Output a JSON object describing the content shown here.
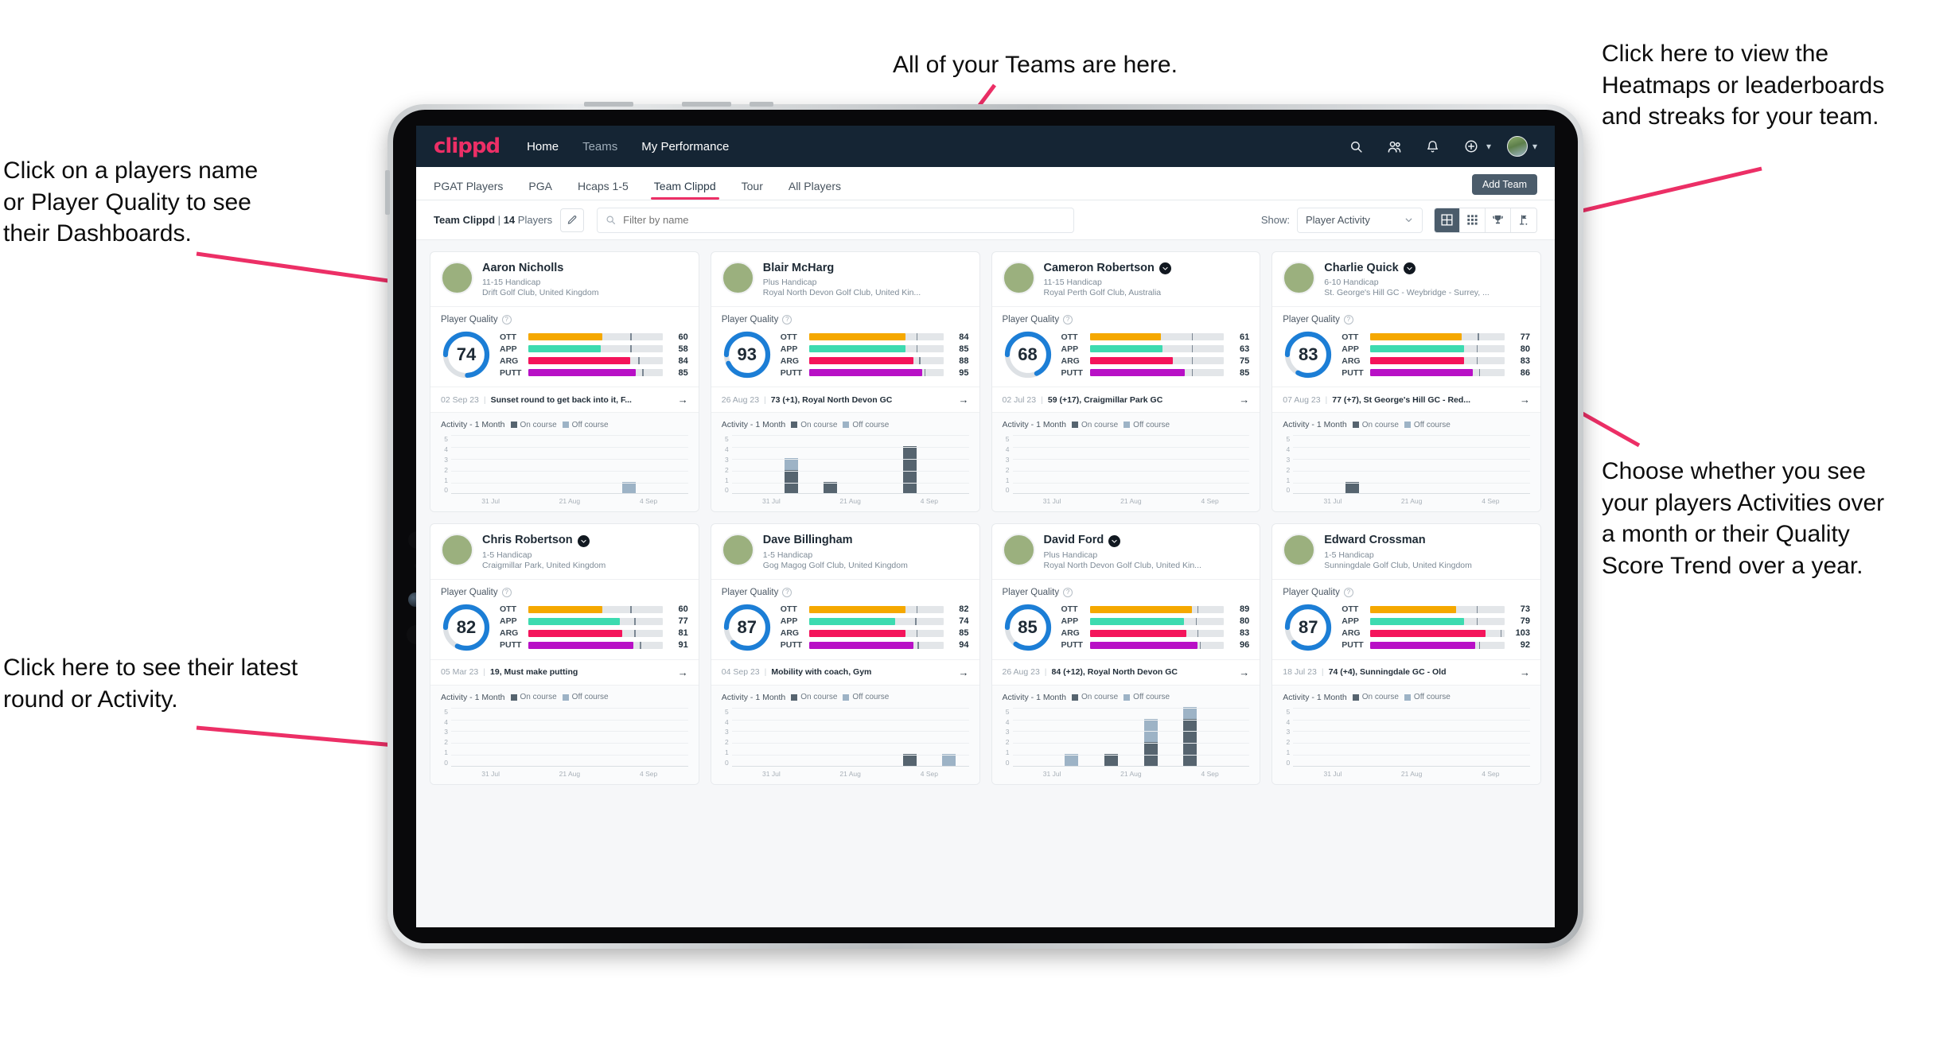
{
  "annotations": {
    "teams": "All of your Teams are here.",
    "heatmaps": "Click here to view the\nHeatmaps or leaderboards\nand streaks for your team.",
    "names": "Click on a players name\nor Player Quality to see\ntheir Dashboards.",
    "show": "Choose whether you see\nyour players Activities over\na month or their Quality\nScore Trend over a year.",
    "round": "Click here to see their latest\nround or Activity."
  },
  "colors": {
    "brand_pink": "#ec2f66",
    "topbar": "#152534",
    "ott": "#f5a800",
    "app": "#3ddbb0",
    "arg": "#f4145b",
    "putt": "#b810c6",
    "gauge": "#1c7ed6",
    "on_course": "#56646f",
    "off_course": "#9db3c6"
  },
  "topbar": {
    "logo": "clippd",
    "links": [
      {
        "label": "Home",
        "active": true
      },
      {
        "label": "Teams",
        "active": false
      },
      {
        "label": "My Performance",
        "active": true
      }
    ],
    "icons": [
      "search-icon",
      "people-icon",
      "bell-icon",
      "plus-circle-icon",
      "avatar"
    ]
  },
  "tabs": {
    "items": [
      {
        "label": "PGAT Players",
        "active": false
      },
      {
        "label": "PGA",
        "active": false
      },
      {
        "label": "Hcaps 1-5",
        "active": false
      },
      {
        "label": "Team Clippd",
        "active": true
      },
      {
        "label": "Tour",
        "active": false
      },
      {
        "label": "All Players",
        "active": false
      }
    ],
    "add_team": "Add Team"
  },
  "filterbar": {
    "team_name": "Team Clippd",
    "separator": "|",
    "player_count": "14",
    "players_word": "Players",
    "edit_icon": "pencil-icon",
    "search_placeholder": "Filter by name",
    "search_value": "",
    "show_label": "Show:",
    "show_value": "Player Activity",
    "show_options": [
      "Player Activity",
      "Quality Score Trend"
    ],
    "views": [
      {
        "name": "grid-view",
        "active": true
      },
      {
        "name": "dense-grid-view",
        "active": false
      },
      {
        "name": "trophy-leaderboard-view",
        "active": false
      },
      {
        "name": "golf-flag-heatmap-view",
        "active": false
      }
    ]
  },
  "card_labels": {
    "quality_title": "Player Quality",
    "activity_title": "Activity - 1 Month",
    "legend_on": "On course",
    "legend_off": "Off course",
    "y_ticks": [
      "5",
      "4",
      "3",
      "2",
      "1",
      "0"
    ],
    "x_ticks": [
      "31 Jul",
      "21 Aug",
      "4 Sep"
    ]
  },
  "players": [
    {
      "name": "Aaron Nicholls",
      "verified": false,
      "handicap": "11-15 Handicap",
      "club": "Drift Golf Club, United Kingdom",
      "quality": 74,
      "metrics": [
        {
          "label": "OTT",
          "value": 60,
          "color": "#f5a800",
          "fill_pct": 55,
          "tick_pct": 76
        },
        {
          "label": "APP",
          "value": 58,
          "color": "#3ddbb0",
          "fill_pct": 54,
          "tick_pct": 76
        },
        {
          "label": "ARG",
          "value": 84,
          "color": "#f4145b",
          "fill_pct": 76,
          "tick_pct": 82
        },
        {
          "label": "PUTT",
          "value": 85,
          "color": "#b810c6",
          "fill_pct": 80,
          "tick_pct": 85
        }
      ],
      "round_date": "02 Sep 23",
      "round_text": "Sunset round to get back into it, F...",
      "activity": [
        {
          "on": 0,
          "off": 0
        },
        {
          "on": 0,
          "off": 0
        },
        {
          "on": 0,
          "off": 0
        },
        {
          "on": 0,
          "off": 0
        },
        {
          "on": 0,
          "off": 1
        },
        {
          "on": 0,
          "off": 0
        }
      ]
    },
    {
      "name": "Blair McHarg",
      "verified": false,
      "handicap": "Plus Handicap",
      "club": "Royal North Devon Golf Club, United Kin...",
      "quality": 93,
      "metrics": [
        {
          "label": "OTT",
          "value": 84,
          "color": "#f5a800",
          "fill_pct": 72,
          "tick_pct": 80
        },
        {
          "label": "APP",
          "value": 85,
          "color": "#3ddbb0",
          "fill_pct": 72,
          "tick_pct": 80
        },
        {
          "label": "ARG",
          "value": 88,
          "color": "#f4145b",
          "fill_pct": 78,
          "tick_pct": 82
        },
        {
          "label": "PUTT",
          "value": 95,
          "color": "#b810c6",
          "fill_pct": 84,
          "tick_pct": 86
        }
      ],
      "round_date": "26 Aug 23",
      "round_text": "73 (+1), Royal North Devon GC",
      "activity": [
        {
          "on": 0,
          "off": 0
        },
        {
          "on": 2,
          "off": 1
        },
        {
          "on": 1,
          "off": 0
        },
        {
          "on": 0,
          "off": 0
        },
        {
          "on": 4,
          "off": 0
        },
        {
          "on": 0,
          "off": 0
        }
      ]
    },
    {
      "name": "Cameron Robertson",
      "verified": true,
      "handicap": "11-15 Handicap",
      "club": "Royal Perth Golf Club, Australia",
      "quality": 68,
      "metrics": [
        {
          "label": "OTT",
          "value": 61,
          "color": "#f5a800",
          "fill_pct": 53,
          "tick_pct": 76
        },
        {
          "label": "APP",
          "value": 63,
          "color": "#3ddbb0",
          "fill_pct": 54,
          "tick_pct": 76
        },
        {
          "label": "ARG",
          "value": 75,
          "color": "#f4145b",
          "fill_pct": 62,
          "tick_pct": 76
        },
        {
          "label": "PUTT",
          "value": 85,
          "color": "#b810c6",
          "fill_pct": 71,
          "tick_pct": 76
        }
      ],
      "round_date": "02 Jul 23",
      "round_text": "59 (+17), Craigmillar Park GC",
      "activity": [
        {
          "on": 0,
          "off": 0
        },
        {
          "on": 0,
          "off": 0
        },
        {
          "on": 0,
          "off": 0
        },
        {
          "on": 0,
          "off": 0
        },
        {
          "on": 0,
          "off": 0
        },
        {
          "on": 0,
          "off": 0
        }
      ]
    },
    {
      "name": "Charlie Quick",
      "verified": true,
      "handicap": "6-10 Handicap",
      "club": "St. George's Hill GC - Weybridge - Surrey, ...",
      "quality": 83,
      "metrics": [
        {
          "label": "OTT",
          "value": 77,
          "color": "#f5a800",
          "fill_pct": 68,
          "tick_pct": 80
        },
        {
          "label": "APP",
          "value": 80,
          "color": "#3ddbb0",
          "fill_pct": 70,
          "tick_pct": 79
        },
        {
          "label": "ARG",
          "value": 83,
          "color": "#f4145b",
          "fill_pct": 70,
          "tick_pct": 79
        },
        {
          "label": "PUTT",
          "value": 86,
          "color": "#b810c6",
          "fill_pct": 76,
          "tick_pct": 81
        }
      ],
      "round_date": "07 Aug 23",
      "round_text": "77 (+7), St George's Hill GC - Red...",
      "activity": [
        {
          "on": 0,
          "off": 0
        },
        {
          "on": 1,
          "off": 0
        },
        {
          "on": 0,
          "off": 0
        },
        {
          "on": 0,
          "off": 0
        },
        {
          "on": 0,
          "off": 0
        },
        {
          "on": 0,
          "off": 0
        }
      ]
    },
    {
      "name": "Chris Robertson",
      "verified": true,
      "handicap": "1-5 Handicap",
      "club": "Craigmillar Park, United Kingdom",
      "quality": 82,
      "metrics": [
        {
          "label": "OTT",
          "value": 60,
          "color": "#f5a800",
          "fill_pct": 55,
          "tick_pct": 76
        },
        {
          "label": "APP",
          "value": 77,
          "color": "#3ddbb0",
          "fill_pct": 68,
          "tick_pct": 79
        },
        {
          "label": "ARG",
          "value": 81,
          "color": "#f4145b",
          "fill_pct": 70,
          "tick_pct": 79
        },
        {
          "label": "PUTT",
          "value": 91,
          "color": "#b810c6",
          "fill_pct": 78,
          "tick_pct": 83
        }
      ],
      "round_date": "05 Mar 23",
      "round_text": "19, Must make putting",
      "activity": [
        {
          "on": 0,
          "off": 0
        },
        {
          "on": 0,
          "off": 0
        },
        {
          "on": 0,
          "off": 0
        },
        {
          "on": 0,
          "off": 0
        },
        {
          "on": 0,
          "off": 0
        },
        {
          "on": 0,
          "off": 0
        }
      ]
    },
    {
      "name": "Dave Billingham",
      "verified": false,
      "handicap": "1-5 Handicap",
      "club": "Gog Magog Golf Club, United Kingdom",
      "quality": 87,
      "metrics": [
        {
          "label": "OTT",
          "value": 82,
          "color": "#f5a800",
          "fill_pct": 72,
          "tick_pct": 80
        },
        {
          "label": "APP",
          "value": 74,
          "color": "#3ddbb0",
          "fill_pct": 64,
          "tick_pct": 79
        },
        {
          "label": "ARG",
          "value": 85,
          "color": "#f4145b",
          "fill_pct": 72,
          "tick_pct": 80
        },
        {
          "label": "PUTT",
          "value": 94,
          "color": "#b810c6",
          "fill_pct": 78,
          "tick_pct": 81
        }
      ],
      "round_date": "04 Sep 23",
      "round_text": "Mobility with coach, Gym",
      "activity": [
        {
          "on": 0,
          "off": 0
        },
        {
          "on": 0,
          "off": 0
        },
        {
          "on": 0,
          "off": 0
        },
        {
          "on": 0,
          "off": 0
        },
        {
          "on": 1,
          "off": 0
        },
        {
          "on": 0,
          "off": 1
        }
      ]
    },
    {
      "name": "David Ford",
      "verified": true,
      "handicap": "Plus Handicap",
      "club": "Royal North Devon Golf Club, United Kin...",
      "quality": 85,
      "metrics": [
        {
          "label": "OTT",
          "value": 89,
          "color": "#f5a800",
          "fill_pct": 76,
          "tick_pct": 80
        },
        {
          "label": "APP",
          "value": 80,
          "color": "#3ddbb0",
          "fill_pct": 70,
          "tick_pct": 79
        },
        {
          "label": "ARG",
          "value": 83,
          "color": "#f4145b",
          "fill_pct": 72,
          "tick_pct": 80
        },
        {
          "label": "PUTT",
          "value": 96,
          "color": "#b810c6",
          "fill_pct": 80,
          "tick_pct": 82
        }
      ],
      "round_date": "26 Aug 23",
      "round_text": "84 (+12), Royal North Devon GC",
      "activity": [
        {
          "on": 0,
          "off": 0
        },
        {
          "on": 0,
          "off": 1
        },
        {
          "on": 1,
          "off": 0
        },
        {
          "on": 2,
          "off": 2
        },
        {
          "on": 4,
          "off": 1
        },
        {
          "on": 0,
          "off": 0
        }
      ]
    },
    {
      "name": "Edward Crossman",
      "verified": false,
      "handicap": "1-5 Handicap",
      "club": "Sunningdale Golf Club, United Kingdom",
      "quality": 87,
      "metrics": [
        {
          "label": "OTT",
          "value": 73,
          "color": "#f5a800",
          "fill_pct": 64,
          "tick_pct": 79
        },
        {
          "label": "APP",
          "value": 79,
          "color": "#3ddbb0",
          "fill_pct": 70,
          "tick_pct": 79
        },
        {
          "label": "ARG",
          "value": 103,
          "color": "#f4145b",
          "fill_pct": 86,
          "tick_pct": 97
        },
        {
          "label": "PUTT",
          "value": 92,
          "color": "#b810c6",
          "fill_pct": 78,
          "tick_pct": 81
        }
      ],
      "round_date": "18 Jul 23",
      "round_text": "74 (+4), Sunningdale GC - Old",
      "activity": [
        {
          "on": 0,
          "off": 0
        },
        {
          "on": 0,
          "off": 0
        },
        {
          "on": 0,
          "off": 0
        },
        {
          "on": 0,
          "off": 0
        },
        {
          "on": 0,
          "off": 0
        },
        {
          "on": 0,
          "off": 0
        }
      ]
    }
  ]
}
